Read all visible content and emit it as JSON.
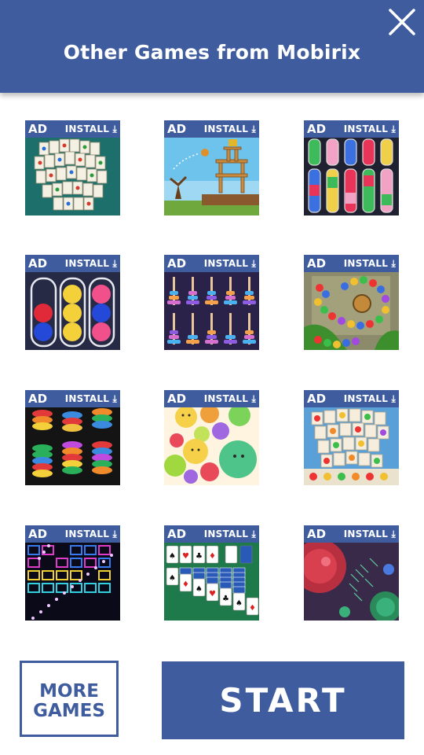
{
  "header": {
    "title": "Other Games from Mobirix",
    "close_icon": "close-icon"
  },
  "tiles": [
    {
      "ad": "AD",
      "install": "INSTALL",
      "game": "mahjong"
    },
    {
      "ad": "AD",
      "install": "INSTALL",
      "game": "angry-birds-style"
    },
    {
      "ad": "AD",
      "install": "INSTALL",
      "game": "water-sort"
    },
    {
      "ad": "AD",
      "install": "INSTALL",
      "game": "ball-sort"
    },
    {
      "ad": "AD",
      "install": "INSTALL",
      "game": "ring-stack"
    },
    {
      "ad": "AD",
      "install": "INSTALL",
      "game": "marble-shooter"
    },
    {
      "ad": "AD",
      "install": "INSTALL",
      "game": "hoop-stack"
    },
    {
      "ad": "AD",
      "install": "INSTALL",
      "game": "fruit-merge"
    },
    {
      "ad": "AD",
      "install": "INSTALL",
      "game": "fruit-tile-match"
    },
    {
      "ad": "AD",
      "install": "INSTALL",
      "game": "brick-breaker"
    },
    {
      "ad": "AD",
      "install": "INSTALL",
      "game": "solitaire"
    },
    {
      "ad": "AD",
      "install": "INSTALL",
      "game": "cell-io"
    }
  ],
  "buttons": {
    "more_line1": "MORE",
    "more_line2": "GAMES",
    "start": "START"
  },
  "colors": {
    "brand": "#3f5c9f",
    "white": "#ffffff"
  }
}
